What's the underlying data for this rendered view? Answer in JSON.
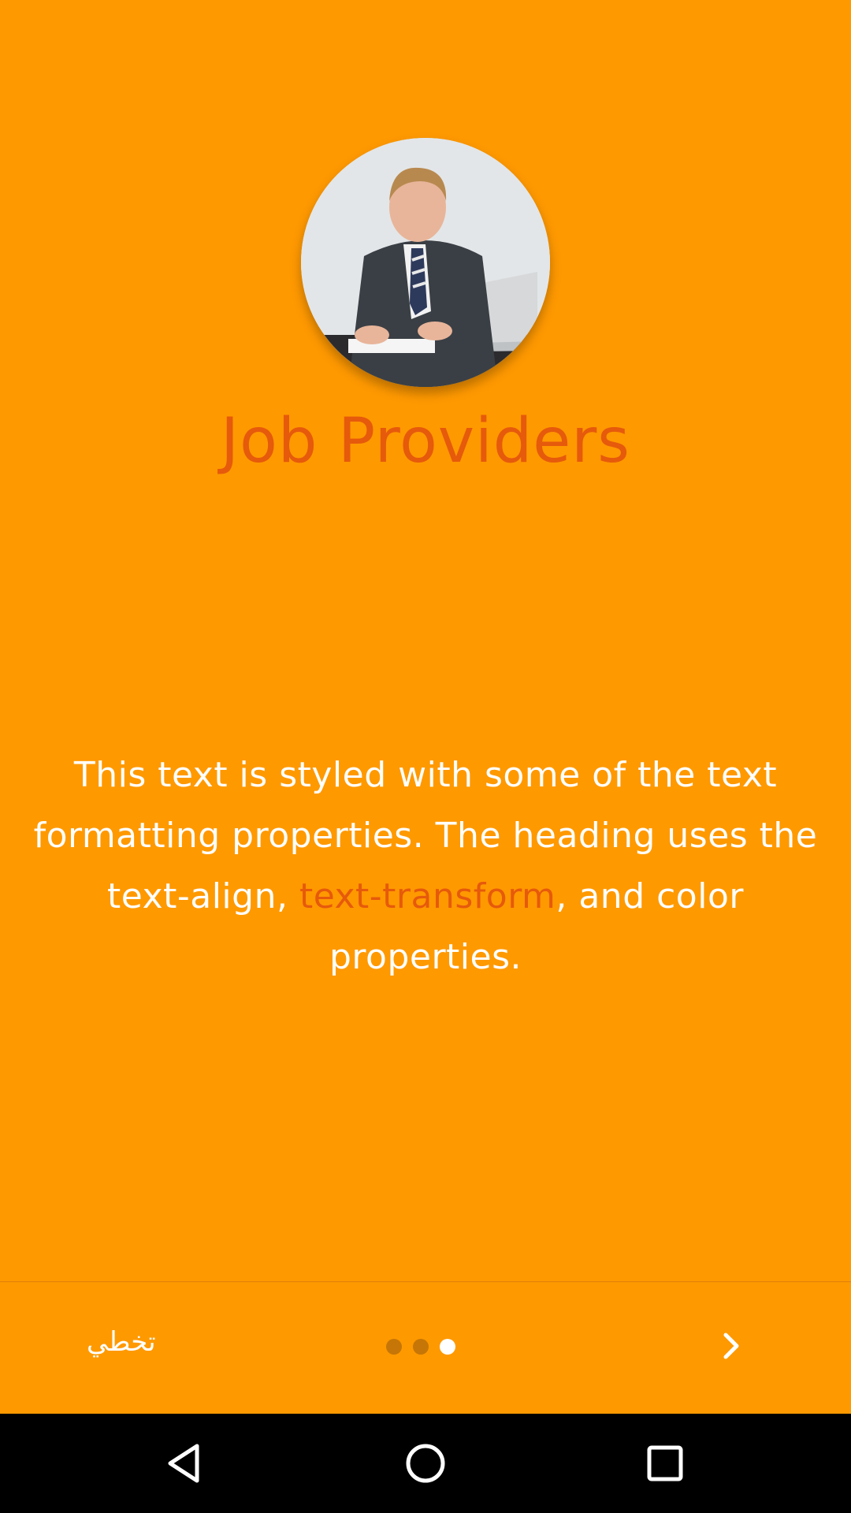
{
  "onboarding": {
    "title": "Job Providers",
    "body_part1": "This text is styled with some of the text formatting properties.  The heading uses the text-align, ",
    "body_highlight": "text-transform",
    "body_part2": ", and color properties.",
    "current_page": 3,
    "total_pages": 3,
    "avatar_icon": "businessman-photo"
  },
  "footer": {
    "skip_label": "تخطي",
    "next_icon": "chevron-right-icon"
  },
  "navbar": {
    "back_icon": "back-triangle-icon",
    "home_icon": "home-circle-icon",
    "recent_icon": "recent-square-icon"
  },
  "colors": {
    "background": "#FF9900",
    "accent": "#E65A0C",
    "text": "#FFFFFF",
    "dot_inactive": "#C57606",
    "dot_active": "#FFFFFF",
    "navbar": "#000000"
  }
}
